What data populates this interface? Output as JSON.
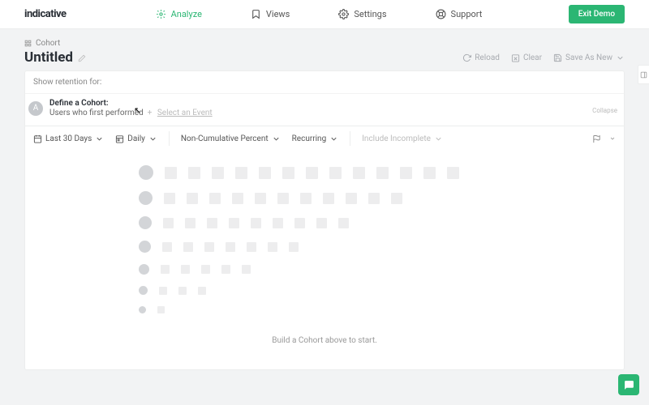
{
  "brand": "indicative",
  "nav": {
    "analyze": "Analyze",
    "views": "Views",
    "settings": "Settings",
    "support": "Support"
  },
  "exit_demo": "Exit Demo",
  "breadcrumb": "Cohort",
  "title": "Untitled",
  "actions": {
    "reload": "Reload",
    "clear": "Clear",
    "save_as_new": "Save As New"
  },
  "show_retention": "Show retention for:",
  "cohort": {
    "badge": "A",
    "define": "Define a Cohort:",
    "sub": "Users who first performed",
    "select_event": "Select an Event",
    "collapse": "Collapse"
  },
  "filters": {
    "date_range": "Last 30 Days",
    "granularity": "Daily",
    "metric": "Non-Cumulative Percent",
    "recurring": "Recurring",
    "include_incomplete": "Include Incomplete"
  },
  "empty_msg": "Build a Cohort above to start.",
  "chart_data": {
    "type": "retention_placeholder",
    "rows": [
      {
        "dot": 18,
        "sq": 15,
        "cells": 13
      },
      {
        "dot": 17,
        "sq": 14,
        "cells": 11
      },
      {
        "dot": 16,
        "sq": 13,
        "cells": 9
      },
      {
        "dot": 15,
        "sq": 12,
        "cells": 7
      },
      {
        "dot": 13,
        "sq": 11,
        "cells": 5
      },
      {
        "dot": 11,
        "sq": 10,
        "cells": 3
      },
      {
        "dot": 9,
        "sq": 9,
        "cells": 1
      }
    ]
  }
}
